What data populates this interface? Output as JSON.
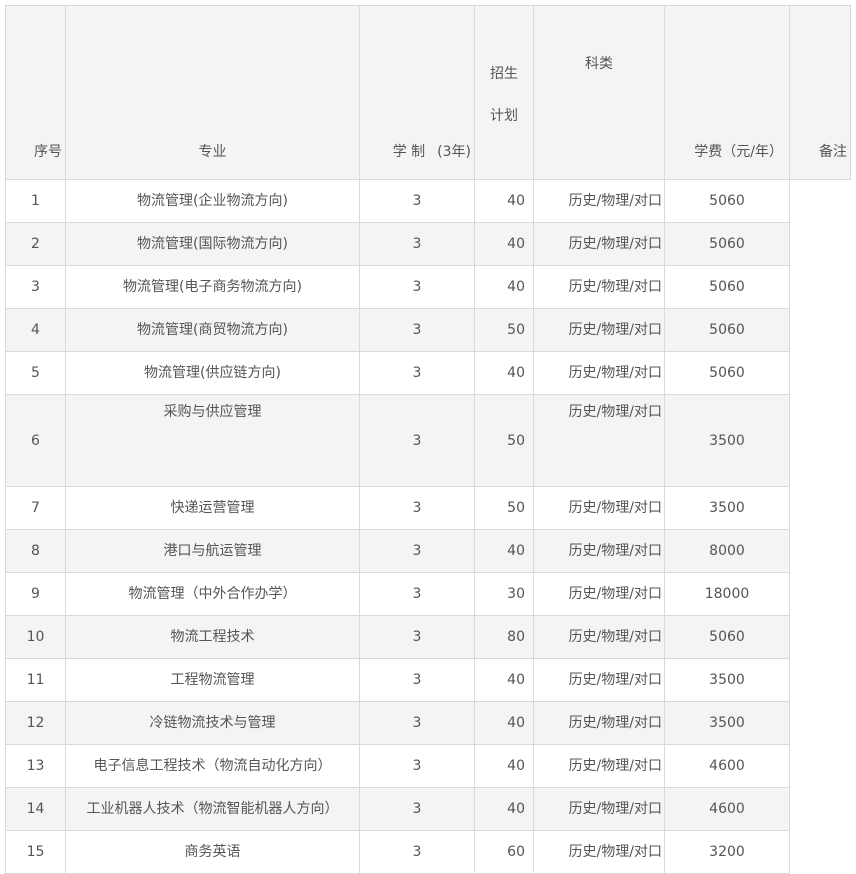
{
  "header": {
    "seq": "序号",
    "major": "专业",
    "duration_a": "学 制",
    "duration_b": "(3年)",
    "enroll_top": "招生",
    "enroll_bottom": "计划",
    "subject": "科类",
    "fee": "学费（元/年）",
    "remark": "备注"
  },
  "rows": [
    {
      "seq": "1",
      "major": "物流管理(企业物流方向)",
      "years": "3",
      "plan": "40",
      "subject": "历史/物理/对口",
      "fee": "5060"
    },
    {
      "seq": "2",
      "major": "物流管理(国际物流方向)",
      "years": "3",
      "plan": "40",
      "subject": "历史/物理/对口",
      "fee": "5060"
    },
    {
      "seq": "3",
      "major": "物流管理(电子商务物流方向)",
      "years": "3",
      "plan": "40",
      "subject": "历史/物理/对口",
      "fee": "5060"
    },
    {
      "seq": "4",
      "major": "物流管理(商贸物流方向)",
      "years": "3",
      "plan": "50",
      "subject": "历史/物理/对口",
      "fee": "5060"
    },
    {
      "seq": "5",
      "major": "物流管理(供应链方向)",
      "years": "3",
      "plan": "40",
      "subject": "历史/物理/对口",
      "fee": "5060"
    },
    {
      "seq": "6",
      "major": "采购与供应管理",
      "years": "3",
      "plan": "50",
      "subject": "历史/物理/对口",
      "fee": "3500"
    },
    {
      "seq": "7",
      "major": "快递运营管理",
      "years": "3",
      "plan": "50",
      "subject": "历史/物理/对口",
      "fee": "3500"
    },
    {
      "seq": "8",
      "major": "港口与航运管理",
      "years": "3",
      "plan": "40",
      "subject": "历史/物理/对口",
      "fee": "8000"
    },
    {
      "seq": "9",
      "major": "物流管理（中外合作办学）",
      "years": "3",
      "plan": "30",
      "subject": "历史/物理/对口",
      "fee": "18000"
    },
    {
      "seq": "10",
      "major": "物流工程技术",
      "years": "3",
      "plan": "80",
      "subject": "历史/物理/对口",
      "fee": "5060"
    },
    {
      "seq": "11",
      "major": "工程物流管理",
      "years": "3",
      "plan": "40",
      "subject": "历史/物理/对口",
      "fee": "3500"
    },
    {
      "seq": "12",
      "major": "冷链物流技术与管理",
      "years": "3",
      "plan": "40",
      "subject": "历史/物理/对口",
      "fee": "3500"
    },
    {
      "seq": "13",
      "major": "电子信息工程技术（物流自动化方向）",
      "years": "3",
      "plan": "40",
      "subject": "历史/物理/对口",
      "fee": "4600"
    },
    {
      "seq": "14",
      "major": "工业机器人技术（物流智能机器人方向）",
      "years": "3",
      "plan": "40",
      "subject": "历史/物理/对口",
      "fee": "4600"
    },
    {
      "seq": "15",
      "major": "商务英语",
      "years": "3",
      "plan": "60",
      "subject": "历史/物理/对口",
      "fee": "3200"
    }
  ]
}
